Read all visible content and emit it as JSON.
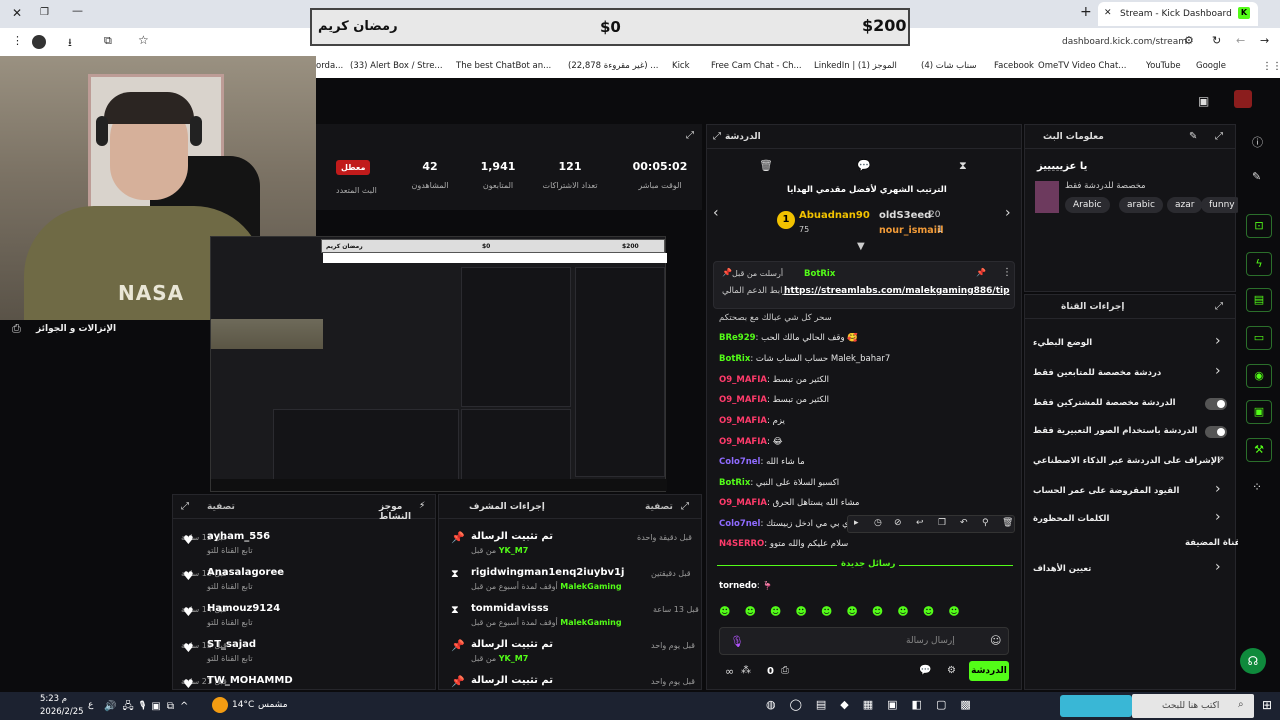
{
  "browser": {
    "tab_title": "Stream - Kick Dashboard",
    "new_tab": "+",
    "close_tab": "✕",
    "url": "dashboard.kick.com/stream",
    "window_minimize": "—",
    "window_restore": "❐",
    "window_close": "✕",
    "bookmarks": [
      {
        "label": "Google"
      },
      {
        "label": "YouTube"
      },
      {
        "label": "OmeTV Video Chat..."
      },
      {
        "label": "Facebook"
      },
      {
        "label": "(4) سناب شات"
      },
      {
        "label": "LinkedIn | (1) الموجز"
      },
      {
        "label": "Free Cam Chat - Ch..."
      },
      {
        "label": "Kick"
      },
      {
        "label": "(22,878 غير مقروءة) ..."
      },
      {
        "label": "The best ChatBot an..."
      },
      {
        "label": "(33) Alert Box / Stre..."
      },
      {
        "label": "orda..."
      }
    ]
  },
  "banner": {
    "title": "رمضان كريم",
    "current": "$0",
    "goal": "$200"
  },
  "webcam_label": "الإنزالات و الجوائز",
  "stats": {
    "live_badge": "معطل",
    "multistream_label": "البث المتعدد",
    "items": [
      {
        "value": "42",
        "label": "المشاهدون"
      },
      {
        "value": "1,941",
        "label": "المتابعون"
      },
      {
        "value": "121",
        "label": "تعداد الاشتراكات"
      },
      {
        "value": "00:05:02",
        "label": "الوقت مباشر"
      }
    ]
  },
  "preview": {
    "banner_title": "رمضان كريم",
    "banner_current": "$0",
    "banner_goal": "$200"
  },
  "activity": {
    "title": "موجز النشاط",
    "filter": "تصفية",
    "rows": [
      {
        "name": "ayham_556",
        "sub": "تابع القناة للتو",
        "time": "قبل 12 ساعة"
      },
      {
        "name": "Anasalagoree",
        "sub": "تابع القناة للتو",
        "time": "قبل 13 ساعة"
      },
      {
        "name": "Hamouz9124",
        "sub": "تابع القناة للتو",
        "time": "قبل 14 ساعة"
      },
      {
        "name": "ST_sajad",
        "sub": "تابع القناة للتو",
        "time": "قبل 15 ساعة"
      },
      {
        "name": "TW_MOHAMMD",
        "sub": "",
        "time": "قبل 21 ساعة"
      }
    ]
  },
  "modactions": {
    "title": "إجراءات المشرف",
    "filter": "تصفية",
    "rows": [
      {
        "title": "تم تثبيت الرسالة",
        "by": "من قبل",
        "mod": "YK_M7",
        "time": "قبل دقيقة واحدة",
        "icon": "pin-icon"
      },
      {
        "title": "rigidwingman1enq2iuybv1j",
        "by": "أوقف لمدة أسبوع من قبل",
        "mod": "MalekGaming",
        "time": "قبل دقيقتين",
        "icon": "hourglass-icon"
      },
      {
        "title": "tommidavisss",
        "by": "أوقف لمدة أسبوع من قبل",
        "mod": "MalekGaming",
        "time": "قبل 13 ساعة",
        "icon": "hourglass-icon"
      },
      {
        "title": "تم تثبيت الرسالة",
        "by": "من قبل",
        "mod": "YK_M7",
        "time": "قبل يوم واحد",
        "icon": "pin-icon"
      },
      {
        "title": "تم تثبيت الرسالة",
        "by": "",
        "mod": "",
        "time": "قبل يوم واحد",
        "icon": "pin-icon"
      }
    ]
  },
  "chat": {
    "title": "الدردشة",
    "leaderboard_title": "الترتيب الشهري لأفضل مقدمي الهدايا",
    "leaders": [
      {
        "rank": "1",
        "name": "Abuadnan90",
        "count": "75"
      },
      {
        "rank": "",
        "name": "oldS3eed",
        "count": "20"
      },
      {
        "rank": "",
        "name": "nour_ismaiil",
        "count": "1"
      }
    ],
    "pinned": {
      "by_label": "أرسلت من قبل",
      "by_user": "BotRix",
      "link": "https://streamlabs.com/malekgaming886/tip",
      "text": "رابط الدعم المالي"
    },
    "messages": [
      {
        "user": "",
        "text": "سحر كل شي عبالك مع بصحتكم",
        "color": "#cccccc"
      },
      {
        "user": "BRe929",
        "text": "وقف الحالي مالك الحب 🥰",
        "color": "#53fc18"
      },
      {
        "user": "BotRix",
        "text": "حساب السناب شات Malek_bahar7",
        "color": "#53fc18"
      },
      {
        "user": "O9_MAFIA",
        "text": "الكثير من تبسط",
        "color": "#ff3b6b"
      },
      {
        "user": "O9_MAFIA",
        "text": "الكثير من تبسط",
        "color": "#ff3b6b"
      },
      {
        "user": "O9_MAFIA",
        "text": "يزم",
        "color": "#ff3b6b"
      },
      {
        "user": "O9_MAFIA",
        "text": "😂",
        "color": "#ff3b6b"
      },
      {
        "user": "Colo7nel",
        "text": "ما شاء الله",
        "color": "#8f6bff"
      },
      {
        "user": "BotRix",
        "text": "اكسبو السلاة على النبي",
        "color": "#53fc18"
      },
      {
        "user": "O9_MAFIA",
        "text": "مشاء الله يستاهل الحرق",
        "color": "#ff3b6b"
      },
      {
        "user": "Colo7nel",
        "text": "بحري بي مي ادخل زبيستك",
        "color": "#8f6bff"
      },
      {
        "user": "N4SERRO",
        "text": "سلام عليكم والله متوو",
        "color": "#ff3b6b"
      }
    ],
    "new_messages": "رسائل جديدة",
    "last_message": {
      "user": "tornedo",
      "text": "🦩"
    },
    "input_placeholder": "إرسال رسالة",
    "send_button": "الدردشة",
    "points": "0"
  },
  "info": {
    "title": "معلومات البث",
    "stream_title": "يا عزيييييز",
    "category": "مخصصة للدردشة فقط",
    "tags": [
      "funny",
      "azar",
      "arabic",
      "Arabic"
    ]
  },
  "channel_actions": {
    "title": "إجراءات القناة",
    "items": [
      {
        "label": "الوضع البطيء",
        "control": "chevron"
      },
      {
        "label": "دردشة مخصصة للمتابعين فقط",
        "control": "chevron"
      },
      {
        "label": "الدردشة مخصصة للمشتركين فقط",
        "control": "toggle"
      },
      {
        "label": "الدردشة باستخدام الصور التعبيرية فقط",
        "control": "toggle"
      },
      {
        "label": "الإشراف على الدردشة عبر الذكاء الاصطناعي",
        "control": "external"
      },
      {
        "label": "القيود المفروضة على عمر الحساب",
        "control": "chevron"
      },
      {
        "label": "الكلمات المحظورة",
        "control": "chevron"
      },
      {
        "label": "القناة المضيفة",
        "control": "none"
      },
      {
        "label": "تعيين الأهداف",
        "control": "chevron"
      }
    ]
  },
  "taskbar": {
    "search": "اكتب هنا للبحث",
    "weather_temp": "14°C",
    "weather_text": "مشمس",
    "time": "5:23 م",
    "date": "2026/2/25",
    "lang": "ع"
  },
  "colors": {
    "accent": "#53fc18",
    "danger": "#e02424",
    "panel": "#141417"
  }
}
